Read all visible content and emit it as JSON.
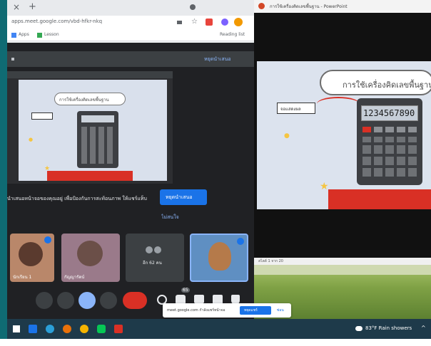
{
  "browser": {
    "tab_new_symbol": "+",
    "close_symbol": "×",
    "url_text": "apps.meet.google.com/vbd-hfkr-nkq",
    "bookmarks": [
      "Apps",
      "Lesson"
    ],
    "reading_list": "Reading list"
  },
  "meet": {
    "stop_presenting_top": "หยุดนำเสนอ",
    "present_notice": "นำเสนอหน้าจอของคุณอยู่ เพื่อป้องกันการสะท้อนภาพ ให้แชร์แท็บ",
    "stop_presenting_button": "หยุดนำเสนอ",
    "dismiss_button": "ไม่สนใจ",
    "others_count": "อีก 62 คน",
    "participant_names": [
      "นักเรียน 1",
      "กัญญารัตน์",
      ""
    ],
    "participants_badge": "65",
    "sharing_bar_text": "meet.google.com กำลังแชร์หน้าจอ",
    "stop_sharing": "หยุดแชร์",
    "hide": "ซ่อน"
  },
  "slide": {
    "window_title": "การใช้เครื่องคิดเลขพื้นฐาน - PowerPoint",
    "title": "การใช้เครื่องคิดเลขพื้นฐาน",
    "label_box": "จอแสดงผล",
    "display_digits": "1234567890",
    "status_bar": "สไลด์ 1 จาก 20"
  },
  "taskbar": {
    "weather": "83°F  Rain showers",
    "chevron": "^"
  },
  "colors": {
    "meet_bg": "#202124",
    "accent_blue": "#1a73e8",
    "red_end": "#d93025"
  }
}
